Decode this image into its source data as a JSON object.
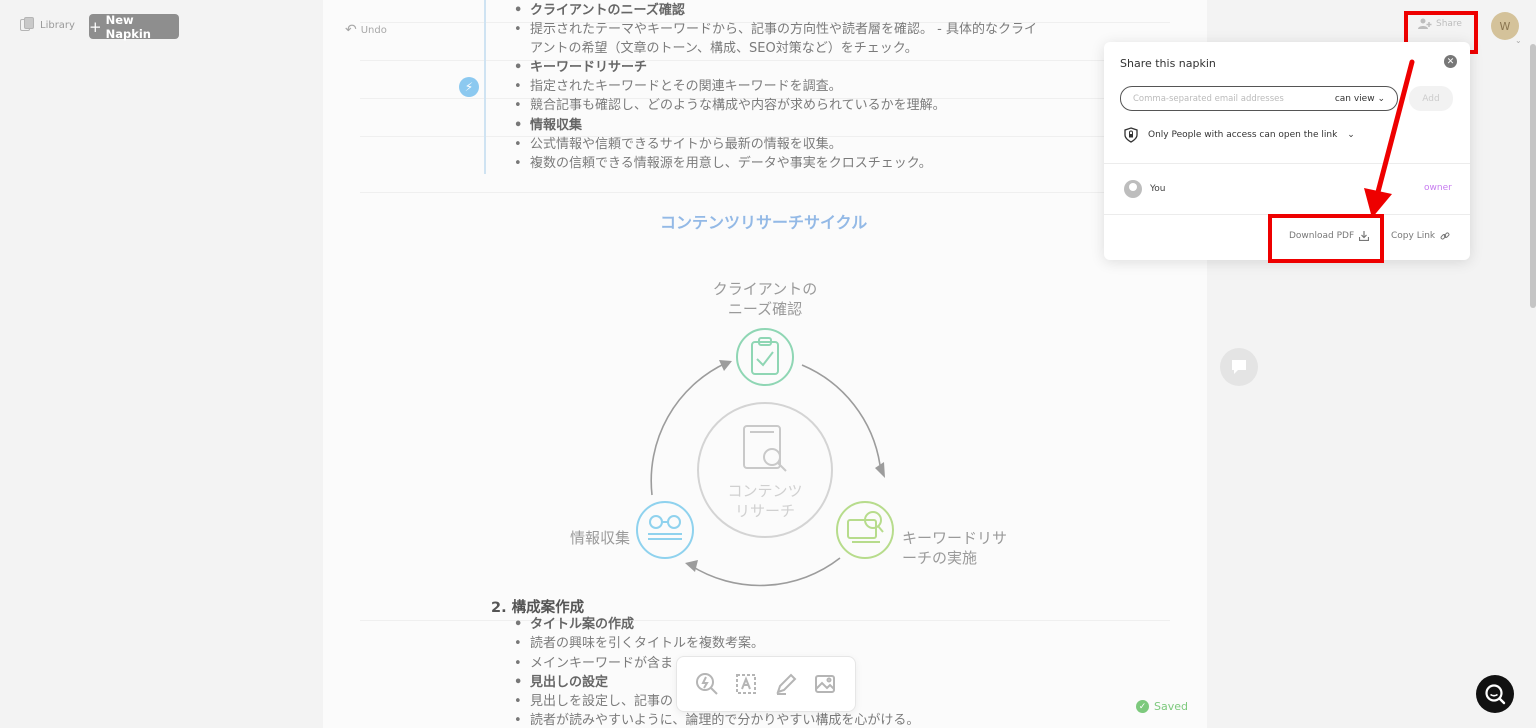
{
  "topbar": {
    "library_label": "Library",
    "new_napkin_label": "New Napkin",
    "undo_label": "Undo",
    "share_label": "Share",
    "avatar_initial": "W"
  },
  "document": {
    "bullets_top": [
      {
        "text": "クライアントのニーズ確認",
        "bold": true
      },
      {
        "text": "提示されたテーマやキーワードから、記事の方向性や読者層を確認。 - 具体的なクライ",
        "bold": false
      },
      {
        "text": "アントの希望（文章のトーン、構成、SEO対策など）をチェック。",
        "bold": false,
        "continuation": true
      },
      {
        "text": "キーワードリサーチ",
        "bold": true
      },
      {
        "text": "指定されたキーワードとその関連キーワードを調査。",
        "bold": false
      },
      {
        "text": "競合記事も確認し、どのような構成や内容が求められているかを理解。",
        "bold": false
      },
      {
        "text": "情報収集",
        "bold": true
      },
      {
        "text": "公式情報や信頼できるサイトから最新の情報を収集。",
        "bold": false
      },
      {
        "text": "複数の信頼できる情報源を用意し、データや事実をクロスチェック。",
        "bold": false
      }
    ],
    "diagram": {
      "title": "コンテンツリサーチサイクル",
      "center_line1": "コンテンツ",
      "center_line2": "リサーチ",
      "node_top_line1": "クライアントの",
      "node_top_line2": "ニーズ確認",
      "node_right_line1": "キーワードリサ",
      "node_right_line2": "ーチの実施",
      "node_left": "情報収集",
      "colors": {
        "top": "#8fd6b4",
        "right": "#b7dc8c",
        "left": "#8fd2ee",
        "center": "#d0d0d0"
      }
    },
    "section2_heading": "2. 構成案作成",
    "bullets_bottom": [
      {
        "text": "タイトル案の作成",
        "bold": true
      },
      {
        "text": "読者の興味を引くタイトルを複数考案。",
        "bold": false
      },
      {
        "text": "メインキーワードが含ま",
        "bold": false
      },
      {
        "text": "見出しの設定",
        "bold": true
      },
      {
        "text": "見出しを設定し、記事の",
        "bold": false
      },
      {
        "text": "読者が読みやすいように、論理的で分かりやすい構成を心がける。",
        "bold": false
      }
    ],
    "saved_label": "Saved"
  },
  "toolbar": {
    "icons": [
      "sparkle-search-icon",
      "text-frame-icon",
      "pen-icon",
      "image-icon"
    ]
  },
  "share_panel": {
    "title": "Share this napkin",
    "email_placeholder": "Comma-separated email addresses",
    "permission": "can view",
    "add_label": "Add",
    "access_label": "Only People with access can open the link",
    "user_name": "You",
    "user_role": "owner",
    "download_pdf_label": "Download PDF",
    "copy_link_label": "Copy Link"
  },
  "annotation": {
    "highlight_color": "#ee0000"
  }
}
